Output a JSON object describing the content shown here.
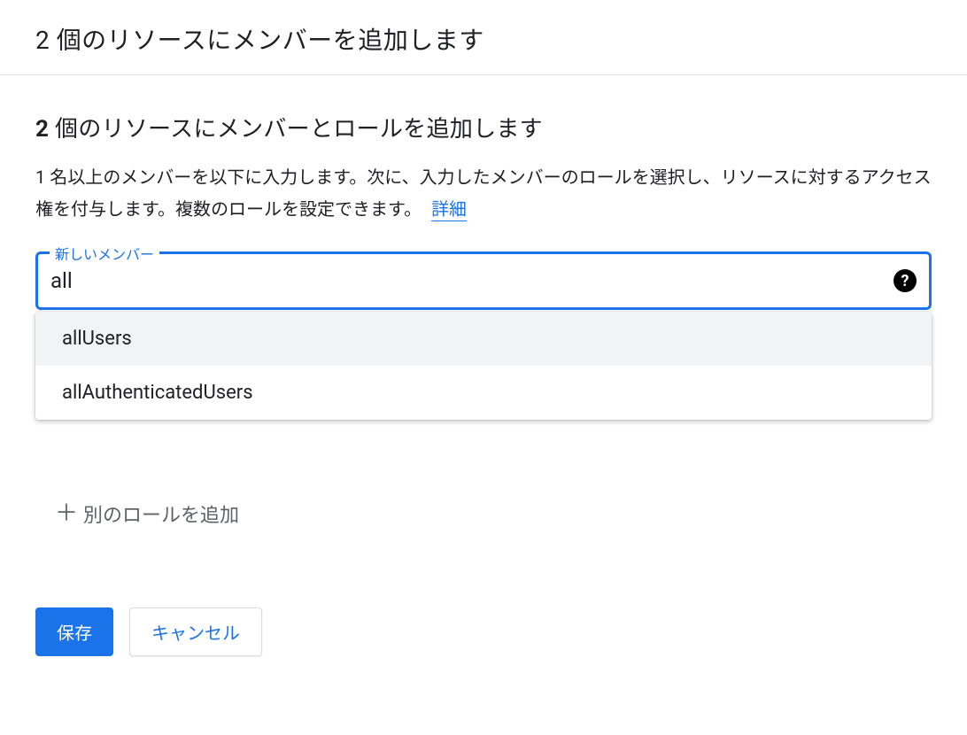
{
  "header": {
    "title": "2 個のリソースにメンバーを追加します"
  },
  "section": {
    "title_prefix_bold": "2",
    "title_rest": " 個のリソースにメンバーとロールを追加します",
    "description": "1 名以上のメンバーを以下に入力します。次に、入力したメンバーのロールを選択し、リソースに対するアクセス権を付与します。複数のロールを設定できます。",
    "learn_more": "詳細"
  },
  "member_field": {
    "label": "新しいメンバー",
    "value": "all",
    "suggestions": [
      {
        "label": "allUsers",
        "highlighted": true
      },
      {
        "label": "allAuthenticatedUsers",
        "highlighted": false
      }
    ]
  },
  "add_role": {
    "label": "別のロールを追加"
  },
  "buttons": {
    "save": "保存",
    "cancel": "キャンセル"
  }
}
